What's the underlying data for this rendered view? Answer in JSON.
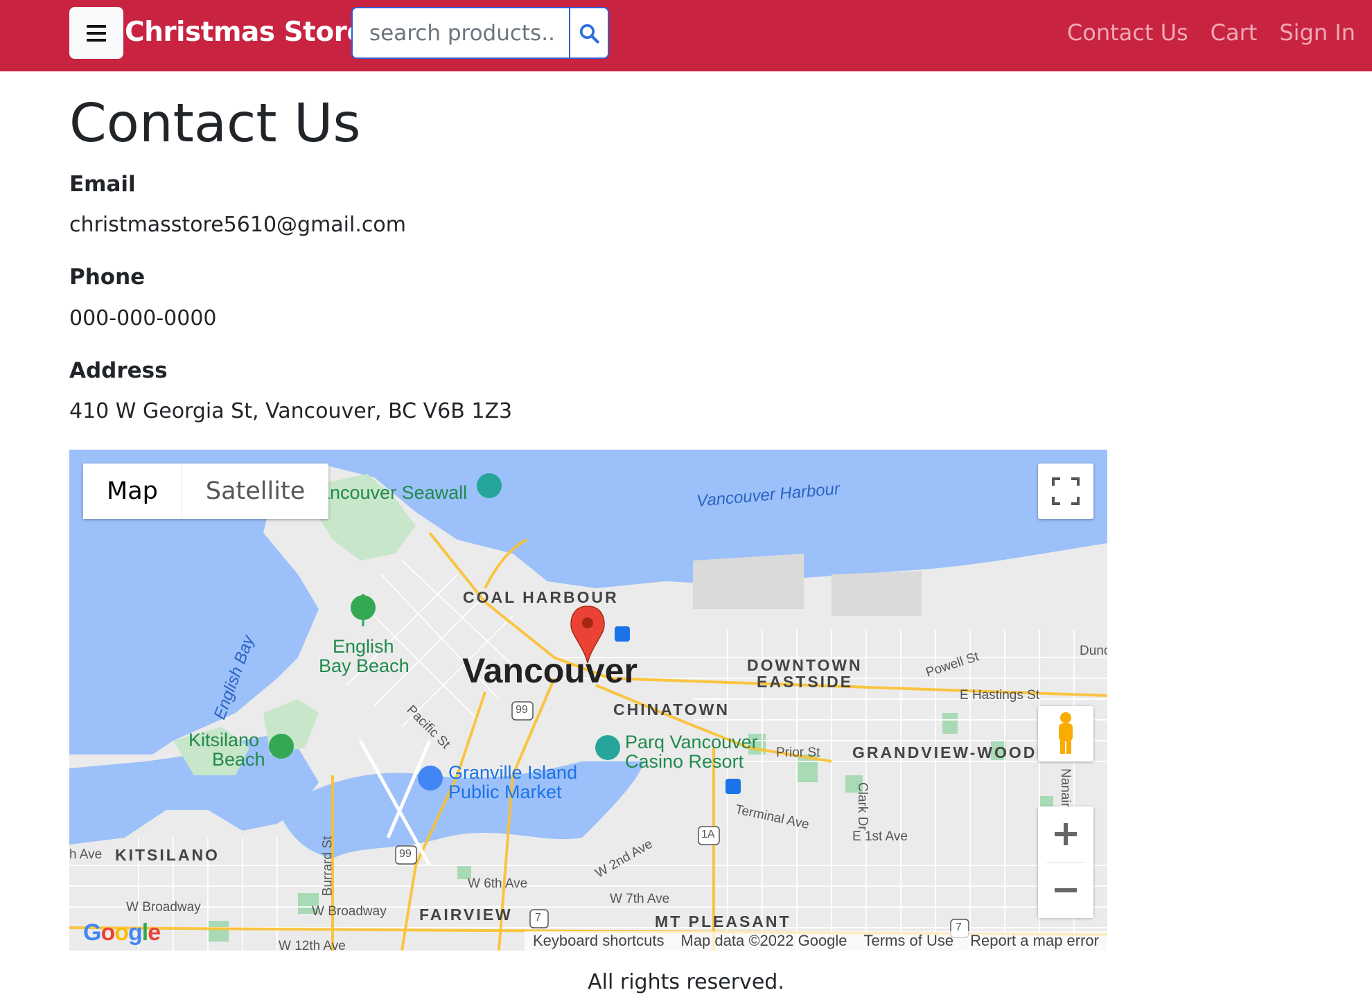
{
  "navbar": {
    "brand": "Christmas Store",
    "search_placeholder": "search products..",
    "links": [
      "Contact Us",
      "Cart",
      "Sign In"
    ],
    "color": "#c82341"
  },
  "page": {
    "title": "Contact Us",
    "email_label": "Email",
    "email": "christmasstore5610@gmail.com",
    "phone_label": "Phone",
    "phone": "000-000-0000",
    "address_label": "Address",
    "address": "410 W Georgia St, Vancouver, BC V6B 1Z3"
  },
  "map": {
    "type_buttons": [
      "Map",
      "Satellite"
    ],
    "active_type": "Map",
    "labels": {
      "city": "Vancouver",
      "seawall": "Vancouver Seawall",
      "harbour": "Vancouver Harbour",
      "coal_harbour": "COAL HARBOUR",
      "english_bay": "English Bay",
      "english_bay_beach_1": "English",
      "english_bay_beach_2": "Bay Beach",
      "downtown_eastside_1": "DOWNTOWN",
      "downtown_eastside_2": "EASTSIDE",
      "chinatown": "CHINATOWN",
      "powell": "Powell St",
      "hastings": "E Hastings St",
      "dun": "Dunc",
      "pacific": "Pacific St",
      "kitsilano_beach_1": "Kitsilano",
      "kitsilano_beach_2": "Beach",
      "parq_1": "Parq Vancouver",
      "parq_2": "Casino Resort",
      "prior": "Prior St",
      "grandview": "GRANDVIEW-WOODLA",
      "granville_1": "Granville Island",
      "granville_2": "Public Market",
      "terminal": "Terminal Ave",
      "clark": "Clark Dr",
      "nanaimo": "Nanair",
      "first_ave": "E 1st Ave",
      "second_ave": "W 2nd Ave",
      "kitsilano": "KITSILANO",
      "h_ave": "h Ave",
      "burrard": "Burrard St",
      "sixth": "W 6th Ave",
      "seventh": "W 7th Ave",
      "broadway_1": "W Broadway",
      "broadway_2": "W Broadway",
      "fairview": "FAIRVIEW",
      "mt_pleasant": "MT PLEASANT",
      "twelfth": "W 12th Ave",
      "hwy99a": "99",
      "hwy99b": "99",
      "hwy1a": "1A",
      "hwy7a": "7",
      "hwy7b": "7"
    },
    "attribution": [
      "Keyboard shortcuts",
      "Map data ©2022 Google",
      "Terms of Use",
      "Report a map error"
    ],
    "logo": "Google"
  },
  "footer": "All rights reserved."
}
